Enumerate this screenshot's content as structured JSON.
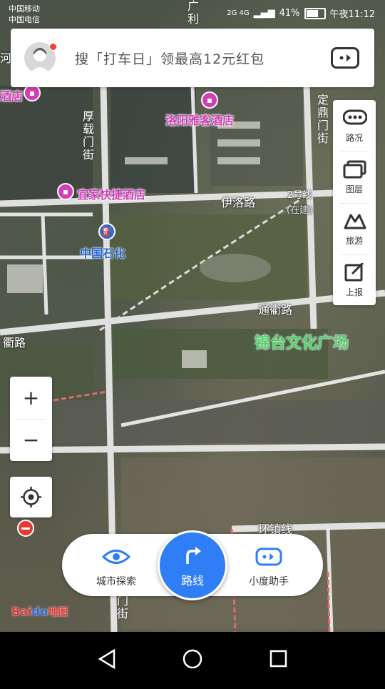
{
  "status_bar": {
    "carrier_line1": "中国移动",
    "carrier_line2": "中国电信",
    "network": "2G 4G",
    "battery_percent": "41%",
    "time": "午夜11:12"
  },
  "search": {
    "placeholder": "搜「打车日」领最高12元红包"
  },
  "side_panel": {
    "items": [
      {
        "label": "路况",
        "icon": "traffic-icon"
      },
      {
        "label": "图层",
        "icon": "layers-icon"
      },
      {
        "label": "旅游",
        "icon": "travel-icon"
      },
      {
        "label": "上报",
        "icon": "report-icon"
      }
    ]
  },
  "zoom": {
    "in_label": "+",
    "out_label": "−"
  },
  "map_labels": {
    "hotel_1": "洛阳雅客酒店",
    "hotel_2": "宜家快捷酒店",
    "hotel_3": "酒店",
    "gas_station": "中国石化",
    "road_yiluo": "伊洛路",
    "road_tongqu": "通衢路",
    "road_tongqu_left": "衢路",
    "road_huanzhen": "环镇线",
    "road_houzai": "厚载门街",
    "road_dingding": "定鼎门街",
    "road_bottom": "门街",
    "road_top": "广利",
    "line2_label": "2号线",
    "line2_status": "(在建)",
    "plaza": "锦台文化广场",
    "edge_left": "河"
  },
  "bottom_bar": {
    "explore_label": "城市探索",
    "route_label": "路线",
    "assistant_label": "小度助手"
  },
  "logo": {
    "text_bai": "Bai",
    "text_du": "du",
    "text_map": "地图"
  },
  "colors": {
    "route_blue": "#2f7ef5",
    "hotel_pink": "#d23db8",
    "plaza_green": "#4fd16a",
    "poi_blue": "#2a6bd6"
  }
}
